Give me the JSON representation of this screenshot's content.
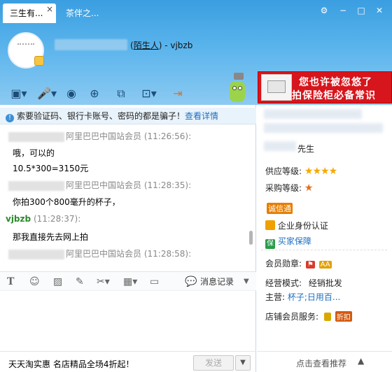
{
  "tabs": [
    {
      "label": "三生有...",
      "close": "×"
    },
    {
      "label": "茶伴之..."
    }
  ],
  "window_controls": {
    "settings": "⚙",
    "minimize": "−",
    "maximize": "□",
    "close": "✕"
  },
  "contact": {
    "relation_link": "陌生人",
    "separator": ") - ",
    "open_paren": "(",
    "user": "vjbzb"
  },
  "ad": {
    "line1": "您也许被忽悠了",
    "line2": "拍保险柜必备常识"
  },
  "warning": {
    "text": "索要验证码、银行卡账号、密码的都是骗子！",
    "link": "查看详情"
  },
  "messages": [
    {
      "sender": "阿里巴巴中国站会员",
      "time": "(11:26:56):",
      "body": "哦，可以的"
    },
    {
      "sender": "",
      "time": "",
      "body": "10.5*300=3150元"
    },
    {
      "sender": "阿里巴巴中国站会员",
      "time": "(11:28:35):",
      "body": "你拍300个800毫升的杯子，"
    },
    {
      "sender": "vjbzb",
      "time": "(11:28:37):",
      "body": "那我直接先去网上拍"
    },
    {
      "sender": "阿里巴巴中国站会员",
      "time": "(11:28:58):",
      "body": ""
    }
  ],
  "input_toolbar": {
    "message_record": "消息记录"
  },
  "footer": {
    "ad_text": "天天淘实惠  名店精品全场4折起！",
    "send": "发送",
    "send_drop": "▼"
  },
  "right": {
    "suffix": "先生",
    "supply_label": "供应等级:",
    "purchase_label": "采购等级:",
    "trust_badge": "诚信通",
    "identity": "企业身份认证",
    "buyer_protection": "买家保障",
    "medal_label": "会员勋章:",
    "business_label": "经营模式:",
    "business_value": "经销批发",
    "main_label": "主营:",
    "main_value": "杯子;日用百...",
    "service_label": "店铺会员服务:",
    "service_badge": "折扣",
    "footer_text": "点击查看推荐",
    "footer_arrow": "▲"
  },
  "colors": {
    "header_top": "#3a9ee0",
    "ad_red": "#d6151c",
    "link_blue": "#1e6fc2",
    "star": "#f4a900"
  }
}
